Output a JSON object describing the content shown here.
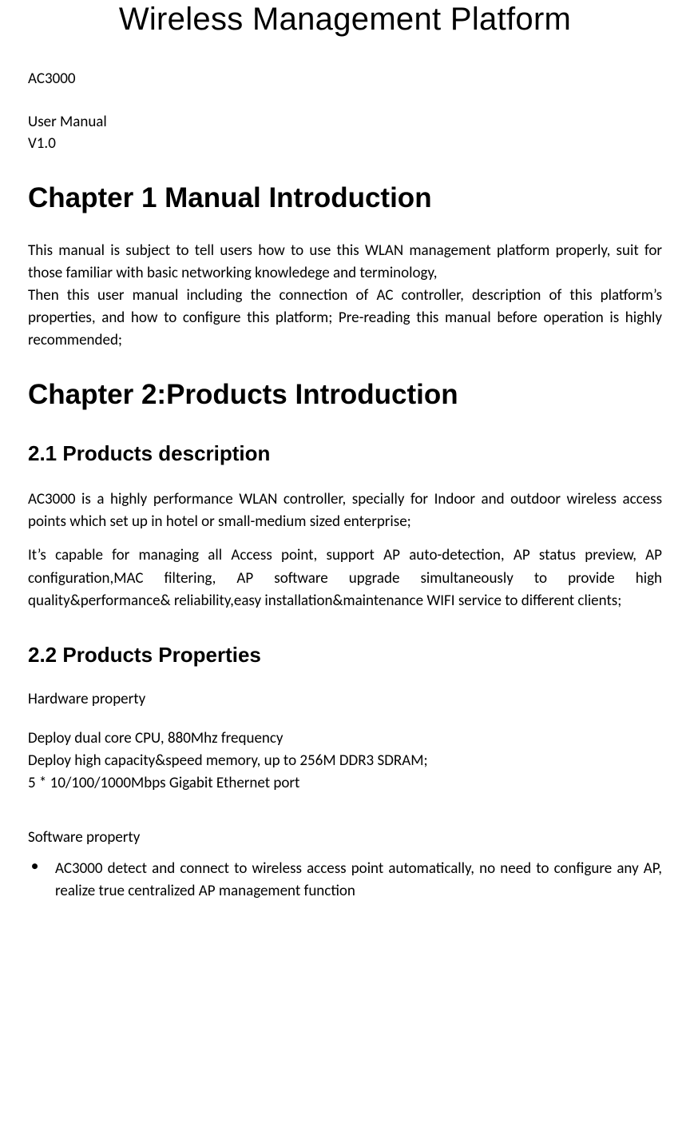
{
  "title": "Wireless Management Platform",
  "meta": {
    "model": "AC3000",
    "doc_type": "User Manual",
    "version": "V1.0"
  },
  "chapter1": {
    "heading": "Chapter 1 Manual Introduction",
    "p1": "This manual is subject to tell users how to use this WLAN management platform properly, suit for those familiar with basic networking knowledege and terminology,",
    "p2": "Then this user manual including the connection of AC controller, description of this platform’s properties, and how to configure this platform; Pre-reading this manual before operation is highly recommended;"
  },
  "chapter2": {
    "heading": "Chapter 2:Products Introduction",
    "s21": {
      "heading": "2.1 Products description",
      "p1": "AC3000 is a highly performance WLAN controller, specially for Indoor and outdoor wireless access points which set up in hotel or small-medium sized enterprise;",
      "p2": "It’s capable for managing all Access point, support AP auto-detection, AP status preview, AP configuration,MAC filtering, AP software upgrade simultaneously to provide high quality&performance& reliability,easy installation&maintenance WIFI service to different clients;"
    },
    "s22": {
      "heading": "2.2 Products Properties",
      "hw_heading": "Hardware property",
      "hw_lines": [
        "Deploy dual core CPU, 880Mhz frequency",
        "Deploy high capacity&speed memory, up to 256M DDR3 SDRAM;",
        "5 * 10/100/1000Mbps Gigabit Ethernet port"
      ],
      "sw_heading": "Software property",
      "sw_bullets": [
        "AC3000 detect and connect to wireless access point automatically, no need to configure any AP, realize true centralized AP management function"
      ]
    }
  }
}
